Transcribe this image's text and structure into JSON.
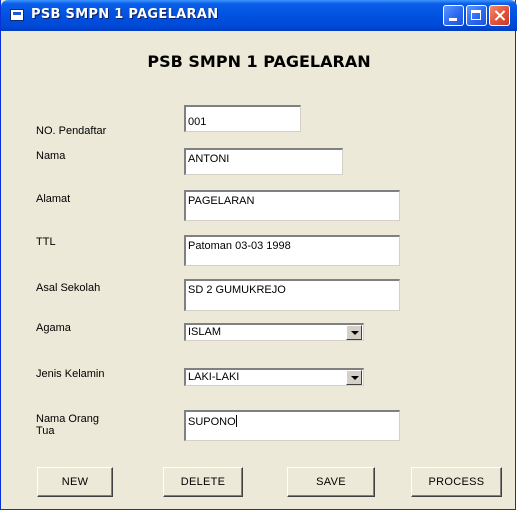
{
  "window": {
    "title": "PSB SMPN 1 PAGELARAN"
  },
  "form": {
    "heading": "PSB SMPN 1 PAGELARAN",
    "fields": {
      "no_pendaftar": {
        "label": "NO. Pendaftar",
        "value": "001"
      },
      "nama": {
        "label": "Nama",
        "value": "ANTONI"
      },
      "alamat": {
        "label": "Alamat",
        "value": "PAGELARAN"
      },
      "ttl": {
        "label": "TTL",
        "value": "Patoman 03-03 1998"
      },
      "asal_sekolah": {
        "label": "Asal Sekolah",
        "value": "SD 2 GUMUKREJO"
      },
      "agama": {
        "label": "Agama",
        "value": "ISLAM"
      },
      "jenis_kelamin": {
        "label": "Jenis Kelamin",
        "value": "LAKI-LAKI"
      },
      "nama_orang_tua": {
        "label_line1": "Nama Orang",
        "label_line2": "Tua",
        "value": "SUPONO"
      }
    }
  },
  "buttons": {
    "new": "NEW",
    "delete": "DELETE",
    "save": "SAVE",
    "process": "PROCESS"
  },
  "icons": {
    "title": "app-window-icon",
    "minimize": "minimize-icon",
    "maximize": "maximize-icon",
    "close": "close-icon",
    "dropdown": "chevron-down-icon"
  },
  "colors": {
    "titlebar": "#0052e0",
    "window_bg": "#ece9d8",
    "close_button": "#e0523a"
  }
}
